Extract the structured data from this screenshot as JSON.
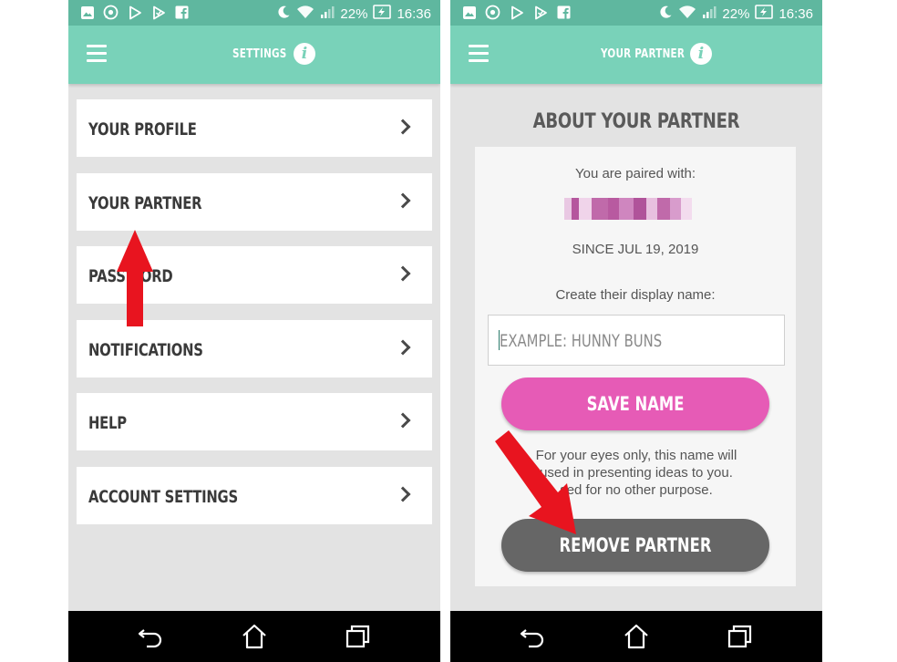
{
  "status_bar": {
    "battery": "22%",
    "time": "16:36"
  },
  "left_screen": {
    "title": "SETTINGS",
    "info_symbol": "i",
    "menu_items": [
      {
        "label": "YOUR PROFILE"
      },
      {
        "label": "YOUR PARTNER"
      },
      {
        "label": "PASSWORD"
      },
      {
        "label": "NOTIFICATIONS"
      },
      {
        "label": "HELP"
      },
      {
        "label": "ACCOUNT SETTINGS"
      }
    ]
  },
  "right_screen": {
    "title": "YOUR PARTNER",
    "info_symbol": "i",
    "section_title": "ABOUT YOUR PARTNER",
    "paired_with_label": "You are paired with:",
    "since_text": "SINCE JUL 19, 2019",
    "display_name_label": "Create their display name:",
    "display_name_placeholder": "EXAMPLE: HUNNY BUNS",
    "save_button_label": "SAVE NAME",
    "note_line1": "For your eyes only, this name will",
    "note_line2": "used in presenting ideas to you.",
    "note_line3": "sed for no other purpose.",
    "remove_button_label": "REMOVE PARTNER"
  },
  "colors": {
    "app_bar": "#79d2b9",
    "status_bar": "#5fb79f",
    "save_button": "#e65bb6",
    "remove_button": "#666666",
    "annotation_arrow": "#e8141f"
  },
  "icons": [
    "gallery-icon",
    "whatsapp-icon",
    "play-store-icon",
    "play-store-icon",
    "facebook-icon",
    "moon-icon",
    "wifi-icon",
    "signal-icon",
    "battery-icon",
    "menu-icon",
    "info-icon",
    "chevron-right-icon",
    "back-icon",
    "home-icon",
    "recents-icon"
  ]
}
